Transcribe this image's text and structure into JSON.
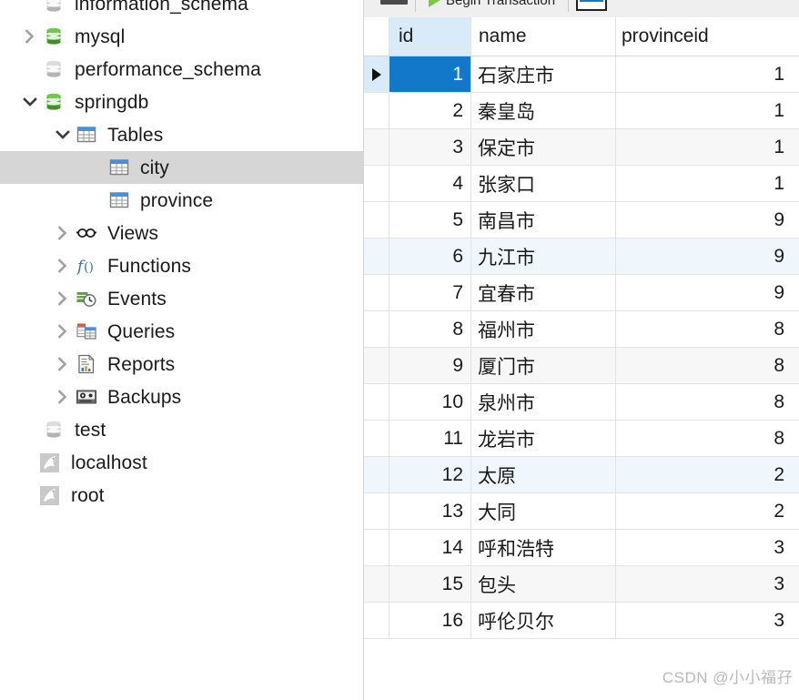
{
  "sidebar": {
    "items": [
      {
        "label": "information_schema",
        "icon": "database-gray-icon",
        "indent": 0,
        "chevron": "none",
        "selected": false,
        "clipped": true
      },
      {
        "label": "mysql",
        "icon": "database-green-icon",
        "indent": 0,
        "chevron": "right",
        "selected": false
      },
      {
        "label": "performance_schema",
        "icon": "database-gray-icon",
        "indent": 0,
        "chevron": "none",
        "selected": false
      },
      {
        "label": "springdb",
        "icon": "database-green-icon",
        "indent": 0,
        "chevron": "down",
        "selected": false
      },
      {
        "label": "Tables",
        "icon": "table-folder-icon",
        "indent": 1,
        "chevron": "down",
        "selected": false
      },
      {
        "label": "city",
        "icon": "table-icon",
        "indent": 2,
        "chevron": "none",
        "selected": true
      },
      {
        "label": "province",
        "icon": "table-icon",
        "indent": 2,
        "chevron": "none",
        "selected": false
      },
      {
        "label": "Views",
        "icon": "views-icon",
        "indent": 1,
        "chevron": "right",
        "selected": false
      },
      {
        "label": "Functions",
        "icon": "function-icon",
        "indent": 1,
        "chevron": "right",
        "selected": false
      },
      {
        "label": "Events",
        "icon": "events-clock-icon",
        "indent": 1,
        "chevron": "right",
        "selected": false
      },
      {
        "label": "Queries",
        "icon": "queries-icon",
        "indent": 1,
        "chevron": "right",
        "selected": false
      },
      {
        "label": "Reports",
        "icon": "reports-icon",
        "indent": 1,
        "chevron": "right",
        "selected": false
      },
      {
        "label": "Backups",
        "icon": "backups-icon",
        "indent": 1,
        "chevron": "right",
        "selected": false
      },
      {
        "label": "test",
        "icon": "database-gray-icon",
        "indent": 0,
        "chevron": "none",
        "selected": false
      },
      {
        "label": "localhost",
        "icon": "mysql-dolphin-icon",
        "indent": -1,
        "chevron": "none",
        "selected": false
      },
      {
        "label": "root",
        "icon": "mysql-dolphin-icon",
        "indent": -1,
        "chevron": "none",
        "selected": false
      }
    ]
  },
  "toolbar": {
    "begin_transaction_label": "Begin Transaction"
  },
  "grid": {
    "columns": [
      "id",
      "name",
      "provinceid"
    ],
    "current_row_index": 0,
    "rows": [
      {
        "id": "1",
        "name": "石家庄市",
        "provinceid": "1",
        "tint": "none"
      },
      {
        "id": "2",
        "name": "秦皇岛",
        "provinceid": "1",
        "tint": "none"
      },
      {
        "id": "3",
        "name": "保定市",
        "provinceid": "1",
        "tint": "gray"
      },
      {
        "id": "4",
        "name": "张家口",
        "provinceid": "1",
        "tint": "none"
      },
      {
        "id": "5",
        "name": "南昌市",
        "provinceid": "9",
        "tint": "none"
      },
      {
        "id": "6",
        "name": "九江市",
        "provinceid": "9",
        "tint": "blue"
      },
      {
        "id": "7",
        "name": "宜春市",
        "provinceid": "9",
        "tint": "none"
      },
      {
        "id": "8",
        "name": "福州市",
        "provinceid": "8",
        "tint": "none"
      },
      {
        "id": "9",
        "name": "厦门市",
        "provinceid": "8",
        "tint": "gray"
      },
      {
        "id": "10",
        "name": "泉州市",
        "provinceid": "8",
        "tint": "none"
      },
      {
        "id": "11",
        "name": "龙岩市",
        "provinceid": "8",
        "tint": "none"
      },
      {
        "id": "12",
        "name": "太原",
        "provinceid": "2",
        "tint": "blue"
      },
      {
        "id": "13",
        "name": "大同",
        "provinceid": "2",
        "tint": "none"
      },
      {
        "id": "14",
        "name": "呼和浩特",
        "provinceid": "3",
        "tint": "none"
      },
      {
        "id": "15",
        "name": "包头",
        "provinceid": "3",
        "tint": "gray"
      },
      {
        "id": "16",
        "name": "呼伦贝尔",
        "provinceid": "3",
        "tint": "none"
      }
    ]
  },
  "watermark": {
    "text": "CSDN @小小福孖"
  },
  "colors": {
    "selection_blue": "#1278ca",
    "header_id_blue": "#d9ebf9",
    "tree_selection_gray": "#d6d6d6",
    "db_green": "#3f9b35",
    "row_tint_gray": "#f7f7f7",
    "row_tint_blue": "#f0f7fc"
  }
}
